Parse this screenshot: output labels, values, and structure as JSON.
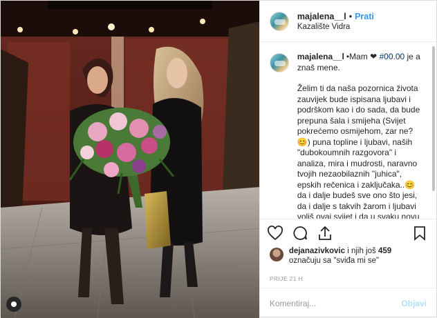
{
  "post": {
    "username": "majalena__l",
    "separator": "•",
    "follow_label": "Prati",
    "location": "Kazalište Vidra"
  },
  "caption": {
    "username": "majalena__l",
    "bullet": "•",
    "intro": "Mam ",
    "heart": "❤",
    "hashtag": "#00.00",
    "intro_rest": " je a znaš mene.",
    "body": "Želim ti da naša pozornica života zauvijek bude ispisana ljubavi i podrškom kao i do sada, da bude prepuna šala i smijeha (Svijet pokrećemo osmijehom, zar ne?😊) puna topline i ljubavi, naših \"dubokoumnih razgovora\" i analiza, mira i mudrosti, naravno tvojih nezaobilaznih \"juhica\", epskih rečenica i zaključaka..😊da i dalje budeš sve ono što jesi, da i dalje s takvih žarom i ljubavi voliš ovaj svijet i da u svaku novu pobjedu ideš s osmijehom i sa svojim ogromnim lavljim srcem, samo onako kako ti znaš."
  },
  "actions": {
    "like_icon": "heart-outline-icon",
    "comment_icon": "speech-bubble-icon",
    "share_icon": "paper-plane-icon",
    "save_icon": "bookmark-icon"
  },
  "likes": {
    "liker": "dejanazivkovic",
    "middle": " i njih još ",
    "count": "459",
    "line2": "označuju sa \"sviđa mi se\""
  },
  "timestamp": "PRIJE 21 H",
  "comment_box": {
    "placeholder": "Komentiraj...",
    "post_label": "Objavi"
  },
  "photo": {
    "tag_icon": "user-tag-icon"
  }
}
